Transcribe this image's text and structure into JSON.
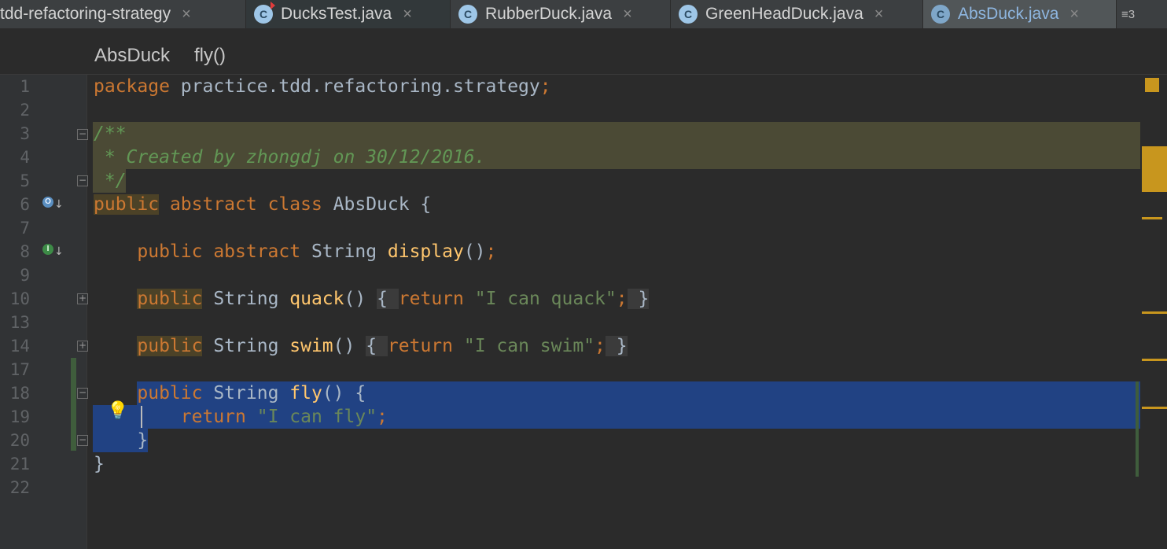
{
  "tabs": [
    {
      "label": "tdd-refactoring-strategy",
      "icon": "none",
      "active": false
    },
    {
      "label": "DucksTest.java",
      "icon": "class-test-icon",
      "active": false
    },
    {
      "label": "RubberDuck.java",
      "icon": "class-icon",
      "active": false
    },
    {
      "label": "GreenHeadDuck.java",
      "icon": "class-icon",
      "active": false
    },
    {
      "label": "AbsDuck.java",
      "icon": "abstract-class-icon",
      "active": true
    }
  ],
  "tab_icon_letter": "C",
  "tab_close_glyph": "×",
  "tab_overflow": "≡3",
  "breadcrumb": {
    "class_name": "AbsDuck",
    "method_name": "fly()"
  },
  "line_numbers": [
    "1",
    "2",
    "3",
    "4",
    "5",
    "6",
    "7",
    "8",
    "9",
    "10",
    "13",
    "14",
    "17",
    "18",
    "19",
    "20",
    "21",
    "22"
  ],
  "code": {
    "l1": {
      "kw": "package",
      "rest": " practice.tdd.refactoring.strategy",
      "semi": ";"
    },
    "l3": "/**",
    "l4": " * Created by zhongdj on 30/12/2016.",
    "l5": " */",
    "l6": {
      "kw1": "public",
      "kw2": " abstract class",
      "rest": " AbsDuck {"
    },
    "l8": {
      "kw": "public abstract",
      "type": " String ",
      "fn": "display",
      "paren": "()",
      "semi": ";"
    },
    "l10": {
      "kw": "public",
      "type": " String ",
      "fn": "quack",
      "paren": "()",
      "sp": " ",
      "lb": "{ ",
      "ret": "return",
      "str": " \"I can quack\"",
      "semi": ";",
      "rb": " }"
    },
    "l14": {
      "kw": "public",
      "type": " String ",
      "fn": "swim",
      "paren": "()",
      "sp": " ",
      "lb": "{ ",
      "ret": "return",
      "str": " \"I can swim\"",
      "semi": ";",
      "rb": " }"
    },
    "l18": {
      "kw": "public",
      "type": " String ",
      "fn": "fly",
      "paren": "() {"
    },
    "l19": {
      "ret": "return",
      "str": " \"I can fly\"",
      "semi": ";"
    },
    "l20": "}",
    "l21": "}"
  },
  "gutter_icons": {
    "override": "O",
    "implement": "I",
    "arrow": "↓"
  },
  "fold_glyphs": {
    "collapse": "−",
    "expand": "+"
  },
  "bulb_glyph": "💡",
  "colors": {
    "keyword": "#cc7832",
    "method": "#ffc66d",
    "string": "#6a8759",
    "comment": "#629755",
    "selection": "#214283",
    "doc_highlight": "#4b4a35",
    "warning_marker": "#c8961e",
    "vcs_marker": "#3f5d3c"
  }
}
